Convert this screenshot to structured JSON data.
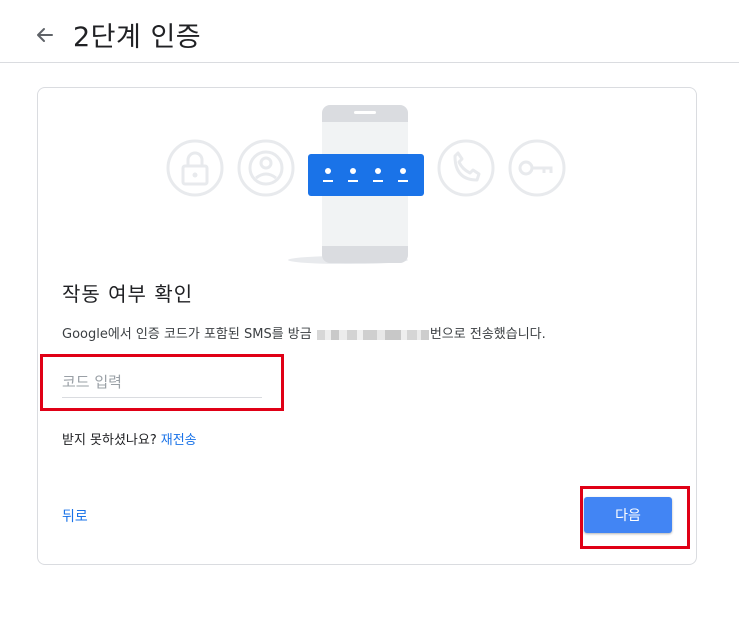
{
  "header": {
    "title": "2단계 인증",
    "back_icon": "arrow-left-icon"
  },
  "illustration": {
    "icons": [
      "lock-icon",
      "account-circle-icon",
      "phone-icon",
      "key-icon"
    ],
    "code_dots": 4,
    "accent_color": "#1a73e8"
  },
  "form": {
    "heading": "작동 여부 확인",
    "description_before": "Google에서 인증 코드가 포함된 SMS를 방금 ",
    "description_after": "번으로 전송했습니다.",
    "code_placeholder": "코드 입력",
    "code_value": "",
    "not_received": "받지 못하셨나요?",
    "resend_label": "재전송",
    "back_label": "뒤로",
    "next_label": "다음"
  },
  "colors": {
    "primary": "#4285f4",
    "link": "#1a73e8",
    "highlight_border": "#e00016"
  }
}
